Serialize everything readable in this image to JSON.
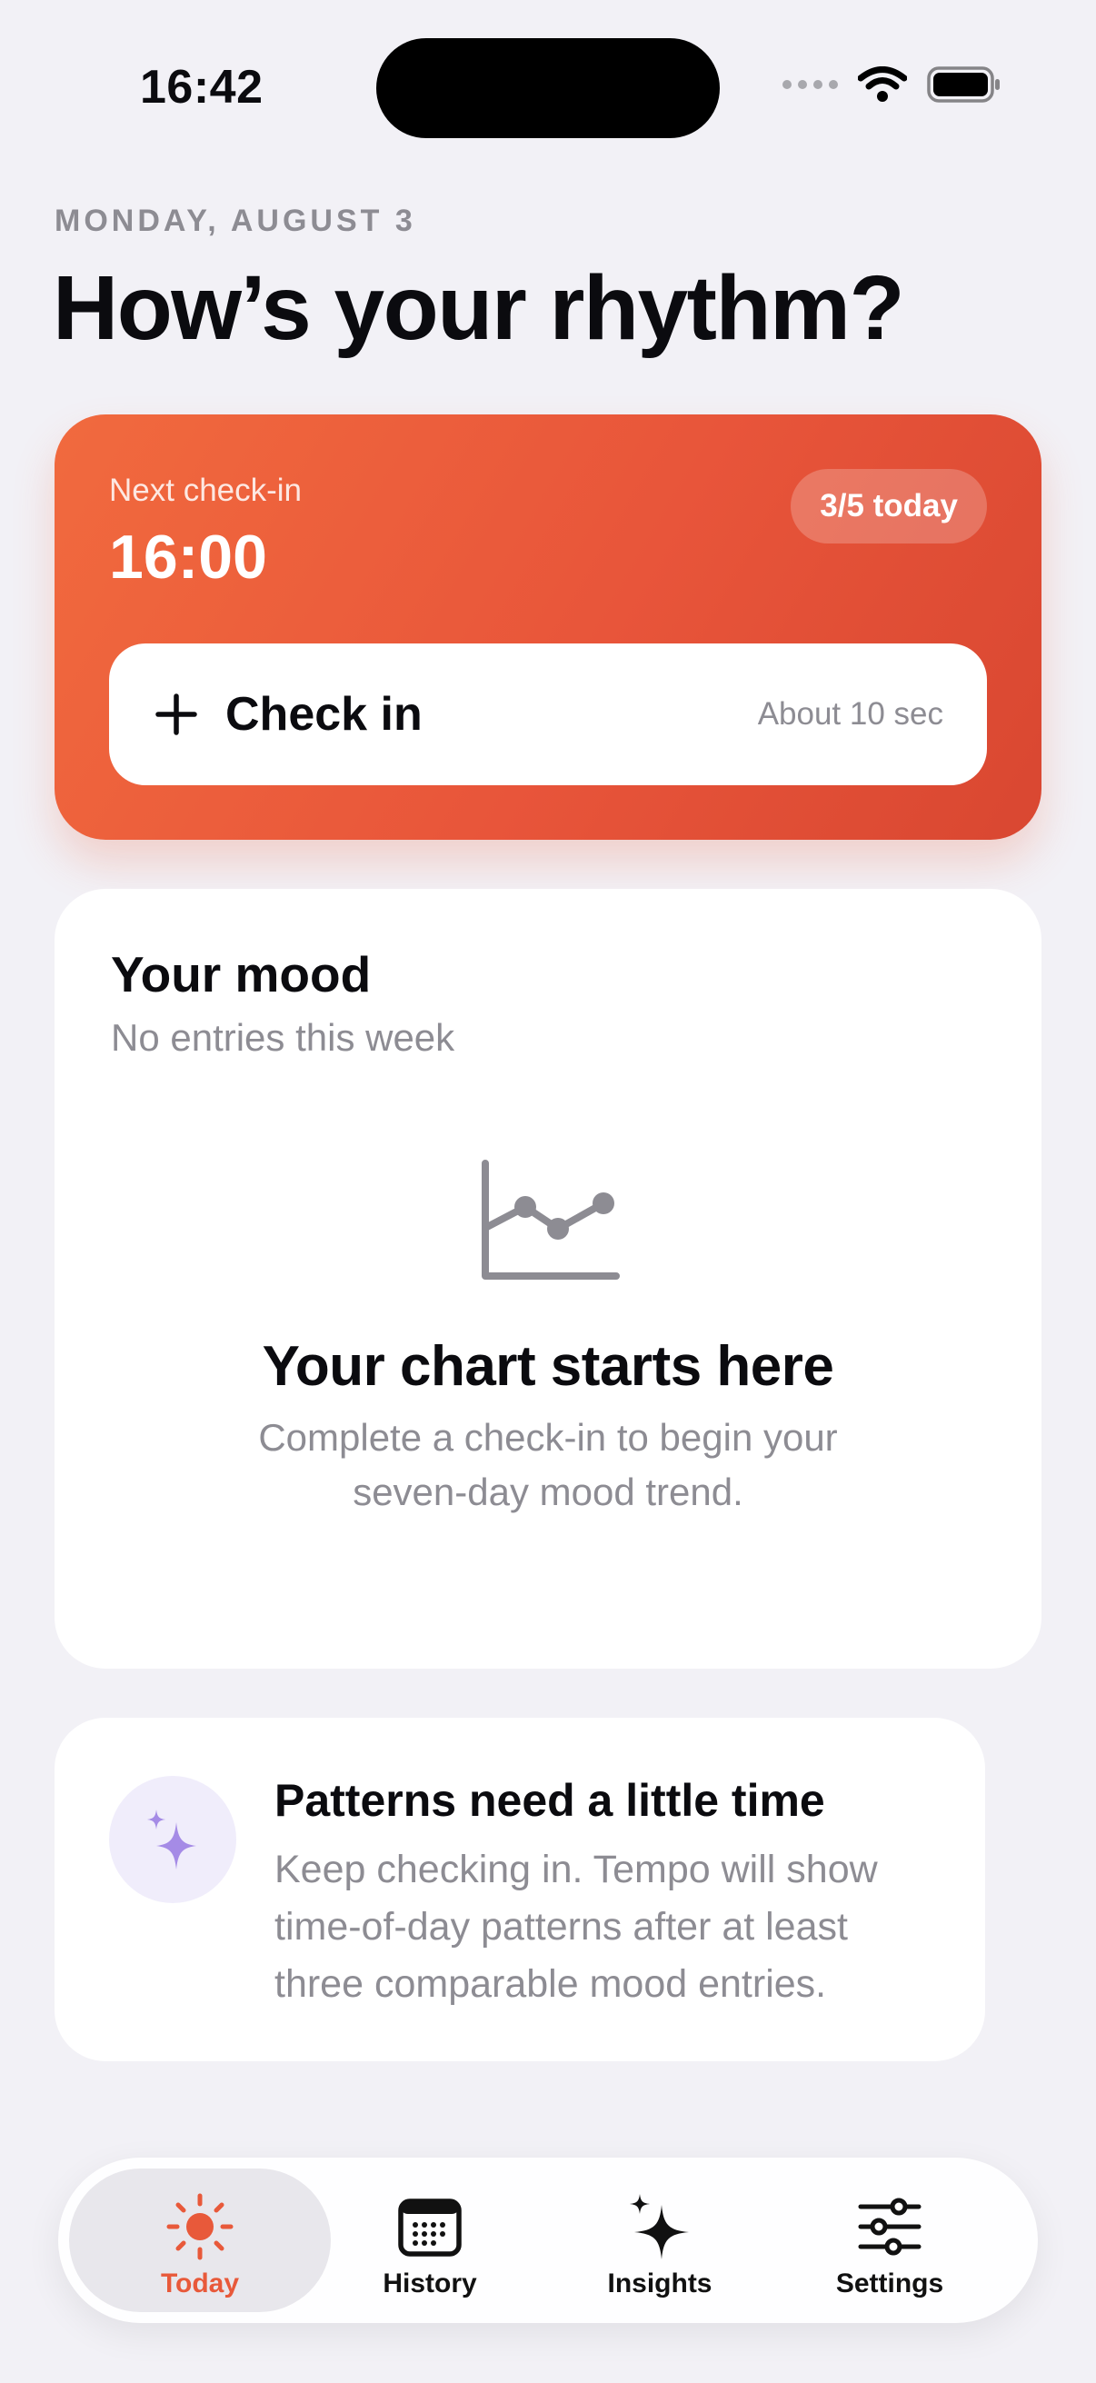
{
  "status_bar": {
    "time": "16:42"
  },
  "header": {
    "date": "MONDAY, AUGUST 3",
    "title": "How’s your rhythm?"
  },
  "checkin_card": {
    "label": "Next check-in",
    "time": "16:00",
    "badge": "3/5 today",
    "button_label": "Check in",
    "button_hint": "About 10 sec"
  },
  "mood_card": {
    "title": "Your mood",
    "subtitle": "No entries this week",
    "empty_title": "Your chart starts here",
    "empty_body": "Complete a check-in to begin your seven-day mood trend.",
    "icon": "line-chart-icon"
  },
  "patterns_card": {
    "title": "Patterns need a little time",
    "body": "Keep checking in. Tempo will show time-of-day patterns after at least three comparable mood entries.",
    "icon": "sparkles-icon"
  },
  "tabbar": {
    "tabs": [
      {
        "label": "Today",
        "icon": "sun-icon",
        "active": true
      },
      {
        "label": "History",
        "icon": "calendar-icon",
        "active": false
      },
      {
        "label": "Insights",
        "icon": "sparkles-icon",
        "active": false
      },
      {
        "label": "Settings",
        "icon": "sliders-icon",
        "active": false
      }
    ]
  },
  "colors": {
    "accent": "#e8593a",
    "background": "#f2f1f6",
    "secondary_text": "#8d8c93",
    "sparkle_purple": "#a58be6"
  }
}
